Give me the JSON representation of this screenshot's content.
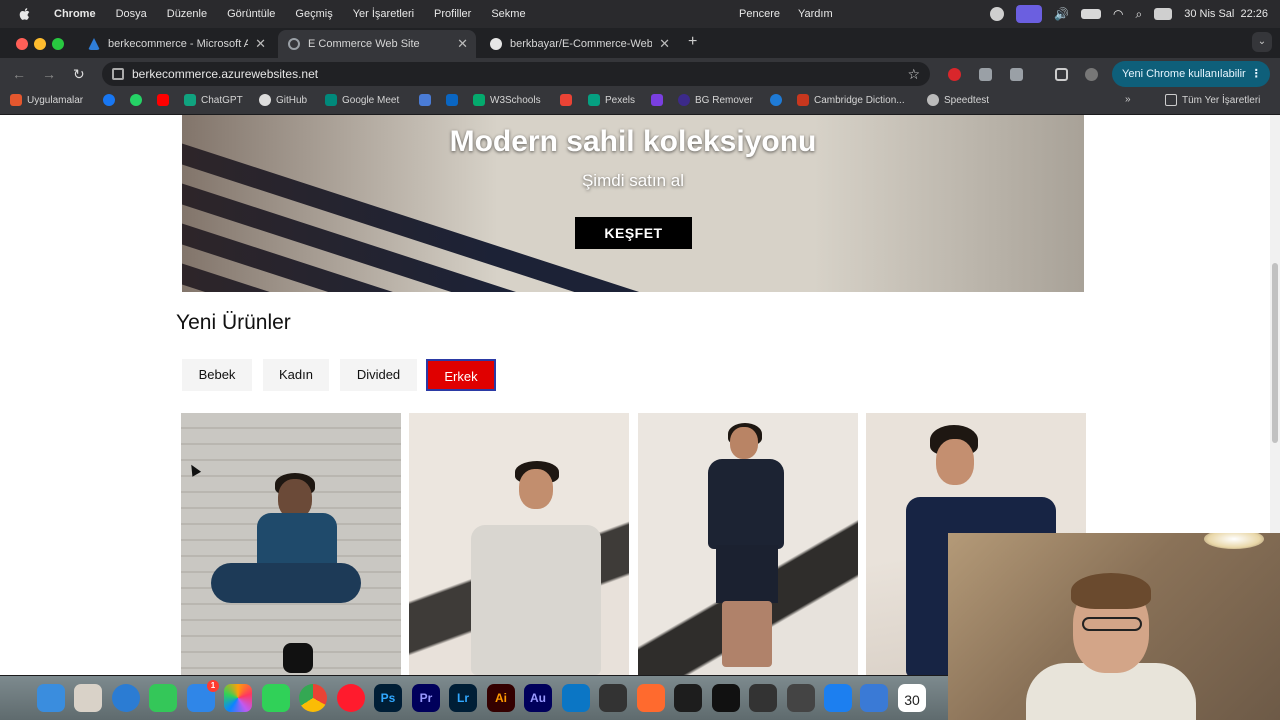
{
  "menubar": {
    "app": "Chrome",
    "items": [
      "Dosya",
      "Düzenle",
      "Görüntüle",
      "Geçmiş",
      "Yer İşaretleri",
      "Profiller",
      "Sekme"
    ],
    "right_items": [
      "Pencere",
      "Yardım"
    ],
    "clock": "30 Nis Sal  22:26"
  },
  "tabs": [
    {
      "title": "berkecommerce - Microsoft A",
      "icon": "azure-icon"
    },
    {
      "title": "E Commerce Web Site",
      "icon": "globe-icon"
    },
    {
      "title": "berkbayar/E-Commerce-Web",
      "icon": "github-icon"
    }
  ],
  "address": {
    "url": "berkecommerce.azurewebsites.net"
  },
  "new_chrome_button": "Yeni Chrome kullanılabilir",
  "bookmarks": [
    {
      "label": "Uygulamalar",
      "color": "#e4572e"
    },
    {
      "label": "",
      "color": "#1877f2"
    },
    {
      "label": "",
      "color": "#25d366"
    },
    {
      "label": "",
      "color": "#ff0000"
    },
    {
      "label": "ChatGPT",
      "color": "#10a37f"
    },
    {
      "label": "GitHub",
      "color": "#dddddd"
    },
    {
      "label": "Google Meet",
      "color": "#00897b"
    },
    {
      "label": "",
      "color": "#4a7cd6"
    },
    {
      "label": "",
      "color": "#0a66c2"
    },
    {
      "label": "W3Schools",
      "color": "#04aa6d"
    },
    {
      "label": "",
      "color": "#ea4335"
    },
    {
      "label": "Pexels",
      "color": "#05a081"
    },
    {
      "label": "",
      "color": "#7a3fe0"
    },
    {
      "label": "BG Remover",
      "color": "#3c2a8a"
    },
    {
      "label": "",
      "color": "#1f7bd6"
    },
    {
      "label": "Cambridge Diction...",
      "color": "#c8371e"
    },
    {
      "label": "Speedtest",
      "color": "#bbbbbb"
    }
  ],
  "all_bookmarks": "Tüm Yer İşaretleri",
  "hero": {
    "title": "Modern sahil koleksiyonu",
    "subtitle": "Şimdi satın al",
    "button": "KEŞFET"
  },
  "products_section": {
    "title": "Yeni Ürünler",
    "categories": [
      {
        "label": "Bebek",
        "active": false
      },
      {
        "label": "Kadın",
        "active": false
      },
      {
        "label": "Divided",
        "active": false
      },
      {
        "label": "Erkek",
        "active": true
      }
    ]
  },
  "dock": {
    "apps": [
      "Ps",
      "Pr",
      "Lr",
      "Ai",
      "Au"
    ],
    "calendar_day": "30",
    "mail_badge": "1"
  }
}
